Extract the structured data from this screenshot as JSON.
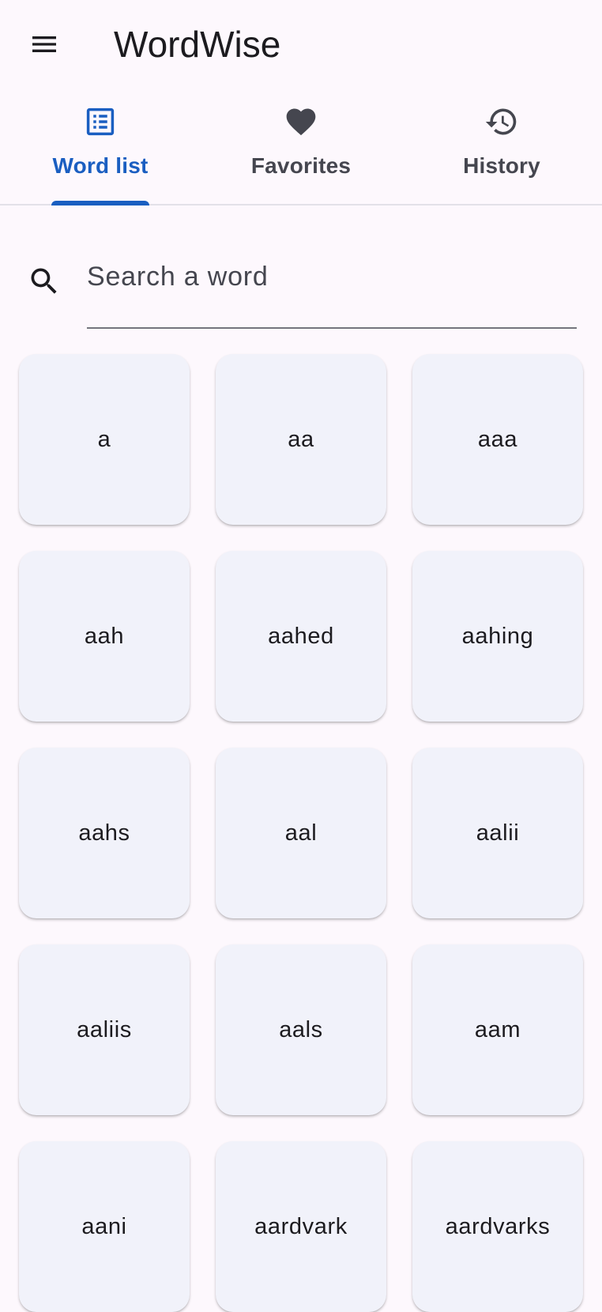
{
  "app_bar": {
    "menu_icon": "menu-icon",
    "title": "WordWise"
  },
  "tabs": [
    {
      "label": "Word list",
      "icon": "list-alt-icon",
      "active": true
    },
    {
      "label": "Favorites",
      "icon": "heart-icon",
      "active": false
    },
    {
      "label": "History",
      "icon": "history-icon",
      "active": false
    }
  ],
  "search": {
    "icon": "search-icon",
    "placeholder": "Search a word",
    "value": ""
  },
  "words": [
    "a",
    "aa",
    "aaa",
    "aah",
    "aahed",
    "aahing",
    "aahs",
    "aal",
    "aalii",
    "aaliis",
    "aals",
    "aam",
    "aani",
    "aardvark",
    "aardvarks"
  ],
  "colors": {
    "accent": "#1a5ec1",
    "background": "#fdf8fd",
    "card": "#f1f2fa",
    "icon": "#45464f"
  }
}
